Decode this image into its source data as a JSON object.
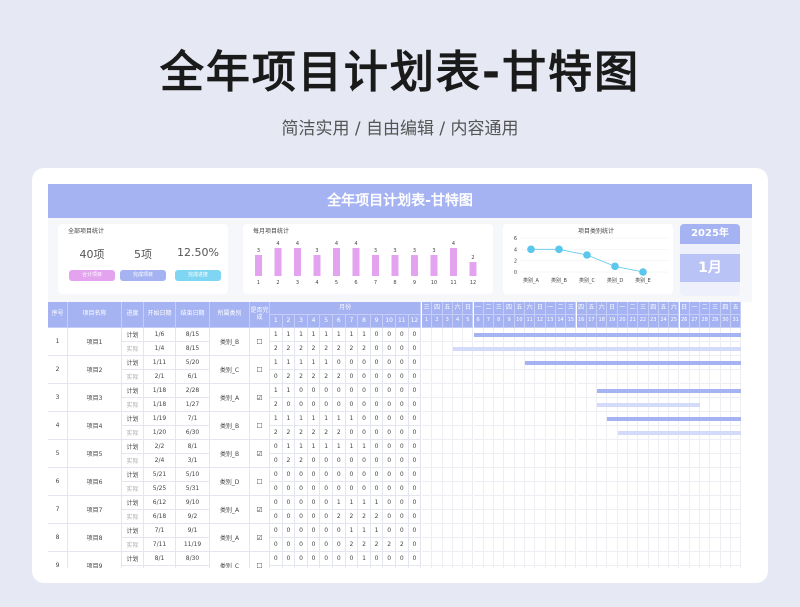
{
  "hero": {
    "title": "全年项目计划表-甘特图",
    "subtitle": "简洁实用 / 自由编辑 / 内容通用"
  },
  "sheet": {
    "banner": "全年项目计划表-甘特图",
    "summary": {
      "title": "全部项目统计",
      "stats": [
        {
          "value": "40项",
          "label": "合计项目",
          "color": "#e3a3ef"
        },
        {
          "value": "5项",
          "label": "完成项目",
          "color": "#a6b3f2"
        },
        {
          "value": "12.50%",
          "label": "完成进度",
          "color": "#7fd6f2"
        }
      ]
    },
    "monthly": {
      "title": "每月项目统计",
      "values": [
        3,
        4,
        4,
        3,
        4,
        4,
        3,
        3,
        3,
        3,
        4,
        2
      ],
      "labels": [
        "1",
        "2",
        "3",
        "4",
        "5",
        "6",
        "7",
        "8",
        "9",
        "10",
        "11",
        "12"
      ],
      "bar_color": "#e3a3ef"
    },
    "category": {
      "title": "项目类别统计",
      "yticks": [
        "6",
        "4",
        "2",
        "0"
      ],
      "ymax": 6,
      "labels": [
        "类别_A",
        "类别_B",
        "类别_C",
        "类别_D",
        "类别_E"
      ],
      "values": [
        4,
        4,
        3,
        1,
        0
      ],
      "point_color": "#5cc7ec"
    },
    "year_label": "2025年",
    "month_label": "1月",
    "table": {
      "headers": {
        "no": "序号",
        "name": "项目名称",
        "progress": "进度",
        "start": "开始日期",
        "end": "结束日期",
        "category": "所属类别",
        "done": "是否完成",
        "months": "月份"
      },
      "month_cols": [
        "1",
        "2",
        "3",
        "4",
        "5",
        "6",
        "7",
        "8",
        "9",
        "10",
        "11",
        "12"
      ],
      "weekdays": [
        "三",
        "四",
        "五",
        "六",
        "日",
        "一",
        "二",
        "三",
        "四",
        "五",
        "六",
        "日",
        "一",
        "二",
        "三",
        "四",
        "五",
        "六",
        "日",
        "一",
        "二",
        "三",
        "四",
        "五",
        "六",
        "日",
        "一",
        "二",
        "三",
        "四",
        "五"
      ],
      "days": [
        "1",
        "2",
        "3",
        "4",
        "5",
        "6",
        "7",
        "8",
        "9",
        "10",
        "11",
        "12",
        "13",
        "14",
        "15",
        "16",
        "17",
        "18",
        "19",
        "20",
        "21",
        "22",
        "23",
        "24",
        "25",
        "26",
        "27",
        "28",
        "29",
        "30",
        "31"
      ],
      "plan_label": "计划",
      "actual_label": "实际",
      "rows": [
        {
          "no": "1",
          "name": "项目1",
          "cat": "类别_B",
          "done": "☐",
          "plan": {
            "start": "1/6",
            "end": "8/15",
            "months": [
              "1",
              "1",
              "1",
              "1",
              "1",
              "1",
              "1",
              "1",
              "0",
              "0",
              "0",
              "0"
            ],
            "bar": [
              6,
              31
            ]
          },
          "actual": {
            "start": "1/4",
            "end": "8/15",
            "months": [
              "2",
              "2",
              "2",
              "2",
              "2",
              "2",
              "2",
              "2",
              "0",
              "0",
              "0",
              "0"
            ],
            "bar": [
              4,
              31
            ]
          }
        },
        {
          "no": "2",
          "name": "项目2",
          "cat": "类别_C",
          "done": "☐",
          "plan": {
            "start": "1/11",
            "end": "5/20",
            "months": [
              "1",
              "1",
              "1",
              "1",
              "1",
              "0",
              "0",
              "0",
              "0",
              "0",
              "0",
              "0"
            ],
            "bar": [
              11,
              31
            ]
          },
          "actual": {
            "start": "2/1",
            "end": "6/1",
            "months": [
              "0",
              "2",
              "2",
              "2",
              "2",
              "2",
              "0",
              "0",
              "0",
              "0",
              "0",
              "0"
            ],
            "bar": null
          }
        },
        {
          "no": "3",
          "name": "项目3",
          "cat": "类别_A",
          "done": "☑",
          "plan": {
            "start": "1/18",
            "end": "2/28",
            "months": [
              "1",
              "1",
              "0",
              "0",
              "0",
              "0",
              "0",
              "0",
              "0",
              "0",
              "0",
              "0"
            ],
            "bar": [
              18,
              31
            ]
          },
          "actual": {
            "start": "1/18",
            "end": "1/27",
            "months": [
              "2",
              "0",
              "0",
              "0",
              "0",
              "0",
              "0",
              "0",
              "0",
              "0",
              "0",
              "0"
            ],
            "bar": [
              18,
              27
            ]
          }
        },
        {
          "no": "4",
          "name": "项目4",
          "cat": "类别_B",
          "done": "☐",
          "plan": {
            "start": "1/19",
            "end": "7/1",
            "months": [
              "1",
              "1",
              "1",
              "1",
              "1",
              "1",
              "1",
              "0",
              "0",
              "0",
              "0",
              "0"
            ],
            "bar": [
              19,
              31
            ]
          },
          "actual": {
            "start": "1/20",
            "end": "6/30",
            "months": [
              "2",
              "2",
              "2",
              "2",
              "2",
              "2",
              "0",
              "0",
              "0",
              "0",
              "0",
              "0"
            ],
            "bar": [
              20,
              31
            ]
          }
        },
        {
          "no": "5",
          "name": "项目5",
          "cat": "类别_B",
          "done": "☑",
          "plan": {
            "start": "2/2",
            "end": "8/1",
            "months": [
              "0",
              "1",
              "1",
              "1",
              "1",
              "1",
              "1",
              "1",
              "0",
              "0",
              "0",
              "0"
            ],
            "bar": null
          },
          "actual": {
            "start": "2/4",
            "end": "3/1",
            "months": [
              "0",
              "2",
              "2",
              "0",
              "0",
              "0",
              "0",
              "0",
              "0",
              "0",
              "0",
              "0"
            ],
            "bar": null
          }
        },
        {
          "no": "6",
          "name": "项目6",
          "cat": "类别_D",
          "done": "☐",
          "plan": {
            "start": "5/21",
            "end": "5/10",
            "months": [
              "0",
              "0",
              "0",
              "0",
              "0",
              "0",
              "0",
              "0",
              "0",
              "0",
              "0",
              "0"
            ],
            "bar": null
          },
          "actual": {
            "start": "5/25",
            "end": "5/31",
            "months": [
              "0",
              "0",
              "0",
              "0",
              "0",
              "0",
              "0",
              "0",
              "0",
              "0",
              "0",
              "0"
            ],
            "bar": null
          }
        },
        {
          "no": "7",
          "name": "项目7",
          "cat": "类别_A",
          "done": "☑",
          "plan": {
            "start": "6/12",
            "end": "9/10",
            "months": [
              "0",
              "0",
              "0",
              "0",
              "0",
              "1",
              "1",
              "1",
              "1",
              "0",
              "0",
              "0"
            ],
            "bar": null
          },
          "actual": {
            "start": "6/18",
            "end": "9/2",
            "months": [
              "0",
              "0",
              "0",
              "0",
              "0",
              "2",
              "2",
              "2",
              "2",
              "0",
              "0",
              "0"
            ],
            "bar": null
          }
        },
        {
          "no": "8",
          "name": "项目8",
          "cat": "类别_A",
          "done": "☑",
          "plan": {
            "start": "7/1",
            "end": "9/1",
            "months": [
              "0",
              "0",
              "0",
              "0",
              "0",
              "0",
              "1",
              "1",
              "1",
              "0",
              "0",
              "0"
            ],
            "bar": null
          },
          "actual": {
            "start": "7/11",
            "end": "11/19",
            "months": [
              "0",
              "0",
              "0",
              "0",
              "0",
              "0",
              "2",
              "2",
              "2",
              "2",
              "2",
              "0"
            ],
            "bar": null
          }
        },
        {
          "no": "9",
          "name": "项目9",
          "cat": "类别_C",
          "done": "☐",
          "plan": {
            "start": "8/1",
            "end": "8/30",
            "months": [
              "0",
              "0",
              "0",
              "0",
              "0",
              "0",
              "0",
              "1",
              "0",
              "0",
              "0",
              "0"
            ],
            "bar": null
          },
          "actual": {
            "start": "",
            "end": "",
            "months": [
              "0",
              "0",
              "0",
              "0",
              "0",
              "0",
              "0",
              "2",
              "0",
              "0",
              "0",
              "0"
            ],
            "bar": null
          }
        }
      ]
    }
  }
}
